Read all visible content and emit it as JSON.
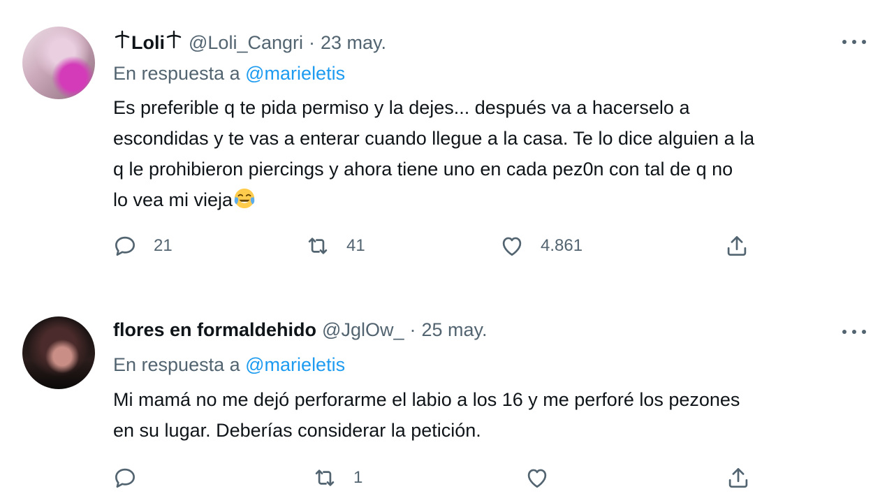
{
  "tweets": [
    {
      "name": "Loli",
      "handle": "@Loli_Cangri",
      "dot": "·",
      "date": "23 may.",
      "reply_prefix": "En respuesta a",
      "reply_mention": "@marieletis",
      "lines": [
        "Es preferible q te pida permiso y la dejes... después va a hacerselo a",
        "escondidas y te vas a enterar cuando llegue a la casa. Te lo dice alguien a la",
        "q le prohibieron piercings y ahora tiene uno en cada pez0n con tal de q no",
        "lo vea mi vieja"
      ],
      "emoji": "face-with-tears-of-joy-icon",
      "stats": {
        "replies": "21",
        "retweets": "41",
        "likes": "4.861"
      }
    },
    {
      "name": "flores en formaldehido",
      "handle": "@JglOw_",
      "dot": "·",
      "date": "25 may.",
      "reply_prefix": "En respuesta a",
      "reply_mention": "@marieletis",
      "lines": [
        "Mi mamá no me dejó perforarme el labio a los 16 y me perforé los pezones",
        "en su lugar. Deberías considerar la petición."
      ],
      "stats": {
        "replies": "",
        "retweets": "1",
        "likes": ""
      }
    }
  ],
  "colors": {
    "text": "#0f1419",
    "secondary": "#536471",
    "link": "#1d9bf0"
  }
}
